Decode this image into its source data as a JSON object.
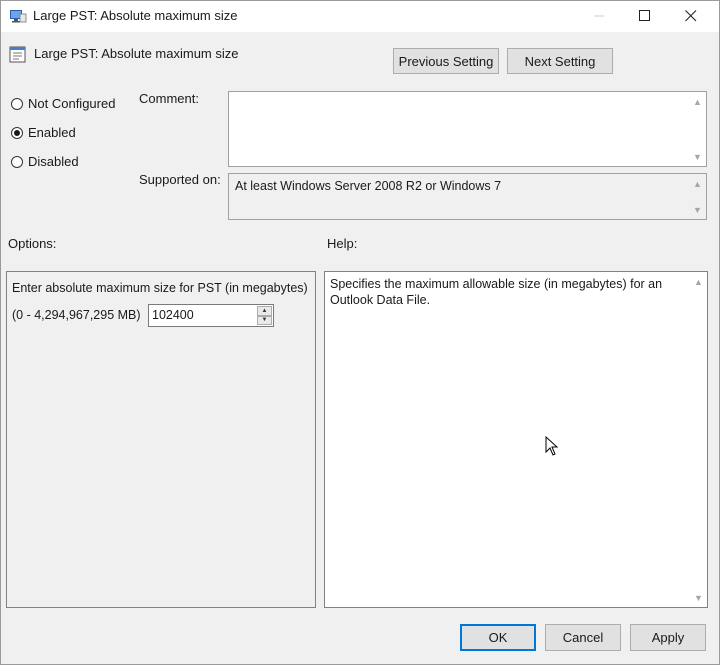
{
  "window": {
    "title": "Large PST: Absolute maximum size",
    "minimize_icon": "minimize-icon",
    "maximize_icon": "maximize-icon",
    "close_icon": "close-icon"
  },
  "header": {
    "title": "Large PST: Absolute maximum size",
    "previous_label": "Previous Setting",
    "next_label": "Next Setting"
  },
  "state": {
    "options": [
      {
        "label": "Not Configured",
        "selected": false
      },
      {
        "label": "Enabled",
        "selected": true
      },
      {
        "label": "Disabled",
        "selected": false
      }
    ]
  },
  "comment": {
    "label": "Comment:",
    "value": ""
  },
  "supported": {
    "label": "Supported on:",
    "value": "At least Windows Server 2008 R2 or Windows 7"
  },
  "options_section": {
    "label": "Options:",
    "description": "Enter absolute maximum size for PST (in megabytes)",
    "range": "(0 - 4,294,967,295 MB)",
    "value": "102400"
  },
  "help_section": {
    "label": "Help:",
    "text": "Specifies the maximum allowable size (in megabytes) for an Outlook Data File."
  },
  "footer": {
    "ok": "OK",
    "cancel": "Cancel",
    "apply": "Apply"
  },
  "colors": {
    "accent": "#0078d7",
    "face": "#f0f0f0",
    "button": "#e1e1e1"
  }
}
